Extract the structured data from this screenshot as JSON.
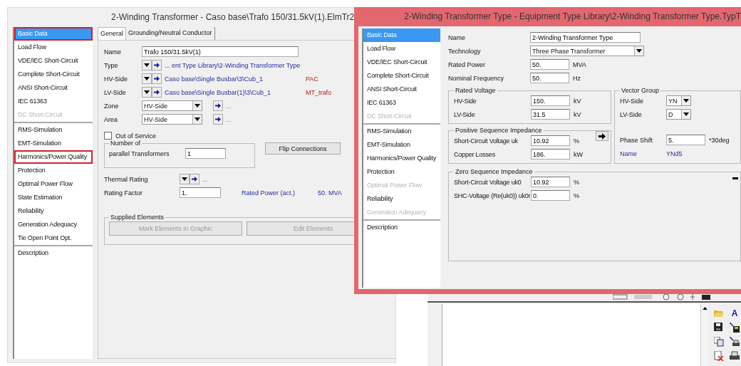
{
  "back_window": {
    "title": "2-Winding Transformer - Caso base\\Trafo 150/31.5kV(1).ElmTr2",
    "sidebar": [
      [
        {
          "label": "Basic Data",
          "selected": true,
          "disabled": false,
          "outlined": true
        },
        {
          "label": "Load Flow",
          "selected": false,
          "disabled": false,
          "outlined": false
        },
        {
          "label": "VDE/IEC Short-Circuit",
          "selected": false,
          "disabled": false,
          "outlined": false
        },
        {
          "label": "Complete Short-Circuit",
          "selected": false,
          "disabled": false,
          "outlined": false
        },
        {
          "label": "ANSI Short-Circuit",
          "selected": false,
          "disabled": false,
          "outlined": false
        },
        {
          "label": "IEC 61363",
          "selected": false,
          "disabled": false,
          "outlined": false
        },
        {
          "label": "DC Short-Circuit",
          "selected": false,
          "disabled": true,
          "outlined": false
        }
      ],
      [
        {
          "label": "RMS-Simulation",
          "selected": false,
          "disabled": false,
          "outlined": false
        },
        {
          "label": "EMT-Simulation",
          "selected": false,
          "disabled": false,
          "outlined": false
        },
        {
          "label": "Harmonics/Power Quality",
          "selected": false,
          "disabled": false,
          "outlined": true
        },
        {
          "label": "Protection",
          "selected": false,
          "disabled": false,
          "outlined": false
        },
        {
          "label": "Optimal Power Flow",
          "selected": false,
          "disabled": false,
          "outlined": false
        },
        {
          "label": "State Estimation",
          "selected": false,
          "disabled": false,
          "outlined": false
        },
        {
          "label": "Reliability",
          "selected": false,
          "disabled": false,
          "outlined": false
        },
        {
          "label": "Generation Adequacy",
          "selected": false,
          "disabled": false,
          "outlined": false
        },
        {
          "label": "Tie Open Point Opt.",
          "selected": false,
          "disabled": false,
          "outlined": false
        }
      ],
      [
        {
          "label": "Description",
          "selected": false,
          "disabled": false,
          "outlined": false
        }
      ]
    ],
    "tabs": [
      {
        "label": "General",
        "selected": true
      },
      {
        "label": "Grounding/Neutral Conductor",
        "selected": false
      }
    ],
    "name": {
      "label": "Name",
      "value": "Trafo 150/31.5kV(1)"
    },
    "links": [
      {
        "label": "Type",
        "path": "... ent Type Library\\2-Winding Transformer Type"
      },
      {
        "label": "HV-Side",
        "path": "Caso base\\Single Busbar\\3\\Cub_1",
        "tag": "PAC"
      },
      {
        "label": "LV-Side",
        "path": "Caso base\\Single Busbar(1)\\3\\Cub_1",
        "tag": "MT_trafo"
      }
    ],
    "selects": [
      {
        "label": "Zone",
        "value": "HV-Side",
        "more": "..."
      },
      {
        "label": "Area",
        "value": "HV-Side",
        "more": "..."
      }
    ],
    "out_of_service": {
      "label": "Out of Service",
      "checked": false
    },
    "number_group": {
      "legend": "Number of",
      "label": "parallel Transformers",
      "value": "1"
    },
    "flip_button": "Flip Connections",
    "thermal_rating": {
      "label": "Thermal Rating",
      "more": "..."
    },
    "rating_factor": {
      "label": "Rating Factor",
      "value": "1.",
      "info_label": "Rated Power (act.)",
      "info_value": "50. MVA"
    },
    "supplied": {
      "legend": "Supplied Elements",
      "buttons": [
        {
          "label": "Mark Elements in Graphic",
          "disabled": true
        },
        {
          "label": "Edit Elements",
          "disabled": true
        }
      ]
    }
  },
  "front_window": {
    "title": "2-Winding Transformer Type - Equipment Type Library\\2-Winding Transformer Type.TypT",
    "sidebar": [
      [
        {
          "label": "Basic Data",
          "selected": true,
          "disabled": false
        },
        {
          "label": "Load Flow",
          "selected": false,
          "disabled": false
        },
        {
          "label": "VDE/IEC Short-Circuit",
          "selected": false,
          "disabled": false
        },
        {
          "label": "Complete Short-Circuit",
          "selected": false,
          "disabled": false
        },
        {
          "label": "ANSI Short-Circuit",
          "selected": false,
          "disabled": false
        },
        {
          "label": "IEC 61363",
          "selected": false,
          "disabled": false
        },
        {
          "label": "DC Short-Circuit",
          "selected": false,
          "disabled": true
        }
      ],
      [
        {
          "label": "RMS-Simulation",
          "selected": false,
          "disabled": false
        },
        {
          "label": "EMT-Simulation",
          "selected": false,
          "disabled": false
        },
        {
          "label": "Harmonics/Power Quality",
          "selected": false,
          "disabled": false
        },
        {
          "label": "Protection",
          "selected": false,
          "disabled": false
        },
        {
          "label": "Optimal Power Flow",
          "selected": false,
          "disabled": true
        },
        {
          "label": "Reliability",
          "selected": false,
          "disabled": false
        },
        {
          "label": "Generation Adequacy",
          "selected": false,
          "disabled": true
        }
      ],
      [
        {
          "label": "Description",
          "selected": false,
          "disabled": false
        }
      ]
    ],
    "top_rows": [
      {
        "kind": "input",
        "label": "Name",
        "value": "2-Winding Transformer Type",
        "wide": true
      },
      {
        "kind": "select",
        "label": "Technology",
        "value": "Three Phase Transformer"
      },
      {
        "kind": "input",
        "label": "Rated Power",
        "value": "50.",
        "unit": "MVA"
      },
      {
        "kind": "input",
        "label": "Nominal Frequency",
        "value": "50.",
        "unit": "Hz"
      }
    ],
    "rated_voltage": {
      "legend": "Rated Voltage",
      "rows": [
        {
          "label": "HV-Side",
          "value": "150.",
          "unit": "kV"
        },
        {
          "label": "LV-Side",
          "value": "31.5",
          "unit": "kV"
        }
      ]
    },
    "positive_sequence": {
      "legend": "Positive Sequence Impedance",
      "rows": [
        {
          "label": "Short-Circuit Voltage uk",
          "value": "10.92",
          "unit": "%"
        },
        {
          "label": "Copper Losses",
          "value": "186.",
          "unit": "kW"
        }
      ]
    },
    "vector_group": {
      "legend": "Vector Group",
      "rows": [
        {
          "label": "HV-Side",
          "value": "YN"
        },
        {
          "label": "LV-Side",
          "value": "D"
        }
      ],
      "phase_shift": {
        "label": "Phase Shift",
        "value": "5.",
        "unit": "*30deg"
      },
      "name": {
        "label": "Name",
        "value": "YNd5"
      }
    },
    "zero_sequence": {
      "legend": "Zero Sequence Impedance",
      "rows": [
        {
          "label": "Short-Circuit Voltage uk0",
          "value": "10.92",
          "unit": "%"
        },
        {
          "label": "SHC-Voltage (Re(uk0)) uk0r",
          "value": "0.",
          "unit": "%"
        }
      ]
    }
  },
  "graphic_panel": {
    "font_button": "A"
  }
}
